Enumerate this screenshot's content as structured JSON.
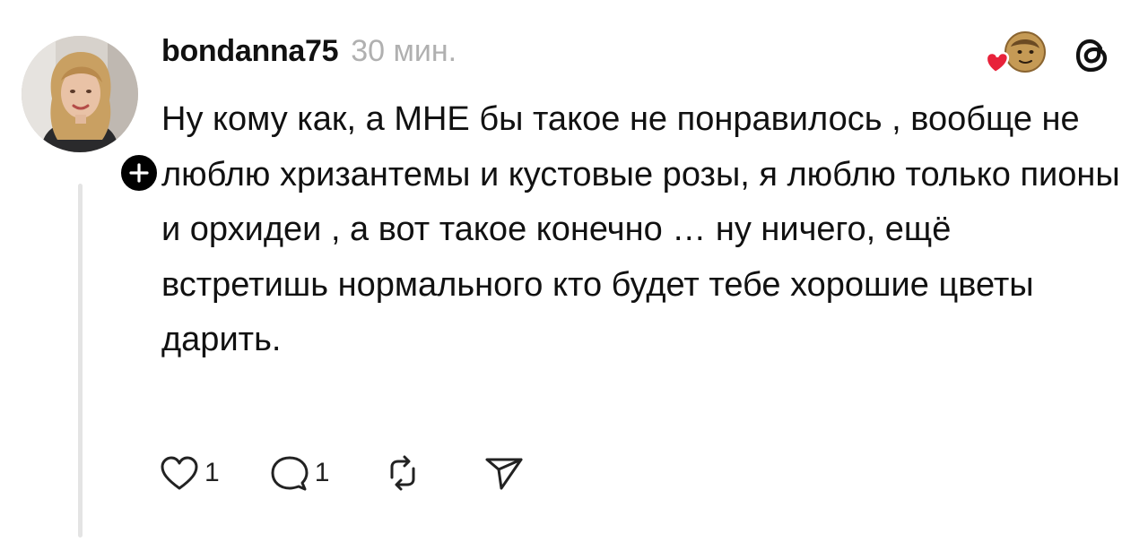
{
  "post": {
    "username": "bondanna75",
    "time": "30 мин.",
    "text": "Ну кому как, а МНЕ бы такое не понравилось , вообще не люблю хризантемы и кустовые розы, я люблю только пионы и орхидеи , а вот такое конечно … ну ничего, ещё встретишь нормального кто будет тебе хорошие цветы дарить.",
    "likes": "1",
    "replies": "1"
  },
  "icons": {
    "follow": "plus-icon",
    "reaction": "heart-with-emoji-avatar",
    "app": "threads-logo",
    "like": "heart-outline-icon",
    "reply": "comment-bubble-icon",
    "repost": "repost-icon",
    "share": "send-icon"
  },
  "colors": {
    "text": "#111111",
    "muted": "#b0b0b0",
    "heart": "#e8223a",
    "thread_line": "#e4e4e4"
  }
}
